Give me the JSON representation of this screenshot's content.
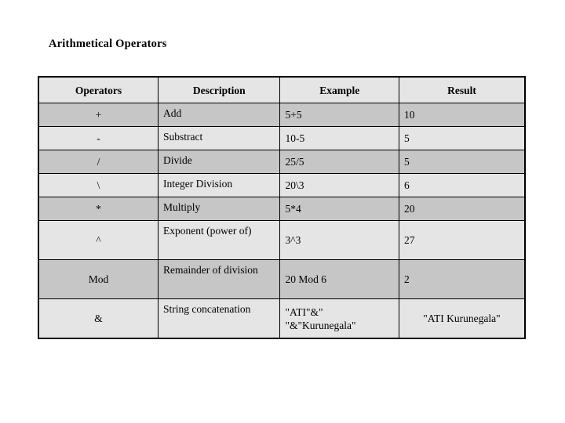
{
  "slide": {
    "title": "Arithmetical Operators",
    "background_color": "#ffffff",
    "text_color": "#000000"
  },
  "table": {
    "name": "arithmetical-operators-table",
    "border_color": "#000000",
    "header_fill": "#e5e5e5",
    "row_fill_dark": "#c6c6c6",
    "row_fill_light": "#e5e5e5",
    "columns": [
      {
        "key": "operator",
        "label": "Operators"
      },
      {
        "key": "description",
        "label": "Description"
      },
      {
        "key": "example",
        "label": "Example"
      },
      {
        "key": "result",
        "label": "Result"
      }
    ],
    "rows": [
      {
        "operator": "+",
        "description": "Add",
        "example": "5+5",
        "result": "10",
        "band": "dark",
        "lines": 1
      },
      {
        "operator": "-",
        "description": "Substract",
        "example": "10-5",
        "result": "5",
        "band": "light",
        "lines": 1
      },
      {
        "operator": "/",
        "description": "Divide",
        "example": "25/5",
        "result": "5",
        "band": "dark",
        "lines": 1
      },
      {
        "operator": "\\",
        "description": "Integer Division",
        "example": "20\\3",
        "result": "6",
        "band": "light",
        "lines": 1
      },
      {
        "operator": "*",
        "description": "Multiply",
        "example": "5*4",
        "result": "20",
        "band": "dark",
        "lines": 1
      },
      {
        "operator": "^",
        "description": "Exponent (power of)",
        "example": "3^3",
        "result": "27",
        "band": "light",
        "lines": 2
      },
      {
        "operator": "Mod",
        "description": "Remainder of division",
        "example": "20 Mod 6",
        "result": "2",
        "band": "dark",
        "lines": 2
      },
      {
        "operator": "&",
        "description": "String concatenation",
        "example_line1": "\"ATI\"&\"",
        "example_line2": "\"&\"Kurunegala\"",
        "example": "\"ATI\"&\" \"&\"Kurunegala\"",
        "result": "\"ATI Kurunegala\"",
        "band": "light",
        "lines": 2
      }
    ]
  }
}
